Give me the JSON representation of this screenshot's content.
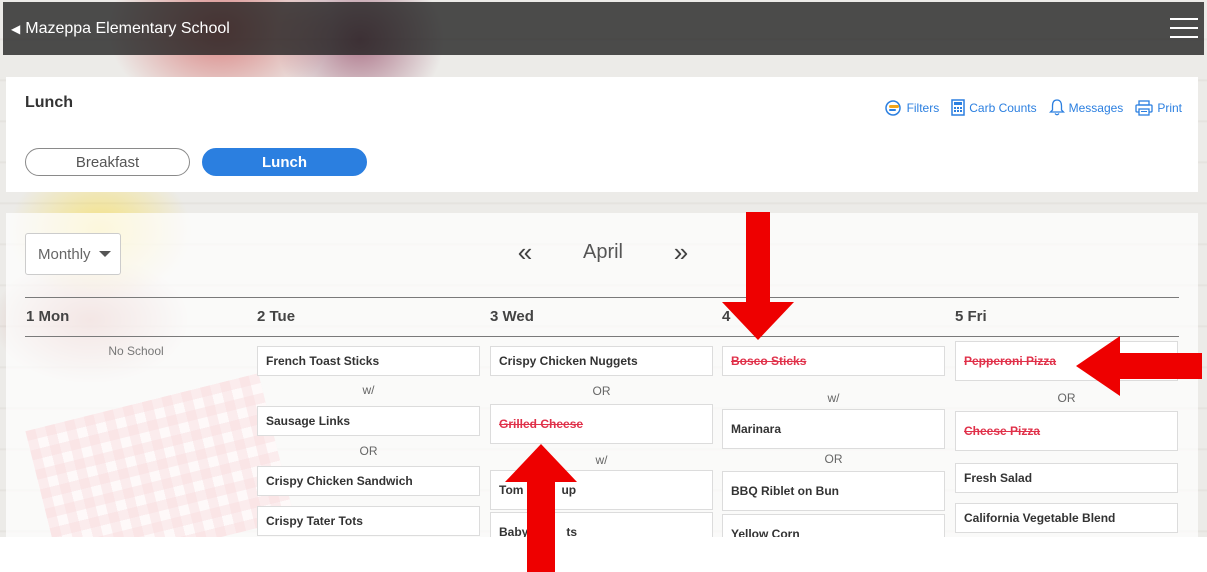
{
  "app": {
    "back_label": "Mazeppa Elementary School"
  },
  "header": {
    "title": "Lunch",
    "tabs": [
      {
        "label": "Breakfast"
      },
      {
        "label": "Lunch"
      }
    ],
    "toolbar": {
      "filters": "Filters",
      "carb_counts": "Carb Counts",
      "messages": "Messages",
      "print": "Print"
    }
  },
  "calendar": {
    "view": "Monthly",
    "month": "April",
    "days": [
      {
        "header": "1 Mon",
        "note": "No School"
      },
      {
        "header": "2 Tue",
        "items": [
          "French Toast Sticks",
          "Sausage Links",
          "Crispy Chicken Sandwich",
          "Crispy Tater Tots"
        ],
        "separators": [
          "w/",
          "OR"
        ]
      },
      {
        "header": "3 Wed",
        "items": [
          "Crispy Chicken Nuggets",
          "Grilled Cheese",
          "Tom",
          "up",
          "Baby",
          "ts"
        ],
        "separators": [
          "OR",
          "w/"
        ]
      },
      {
        "header": "4",
        "items": [
          "Bosco Sticks",
          "Marinara",
          "BBQ Riblet on Bun",
          "Yellow Corn"
        ],
        "separators": [
          "w/",
          "OR"
        ]
      },
      {
        "header": "5 Fri",
        "items": [
          "Pepperoni Pizza",
          "Cheese Pizza",
          "Fresh Salad",
          "California Vegetable Blend"
        ],
        "separators": [
          "OR"
        ]
      }
    ]
  },
  "colors": {
    "accent": "#2b7fe0",
    "strikeout": "#e0314a",
    "annotation_arrow": "#ee0000"
  }
}
